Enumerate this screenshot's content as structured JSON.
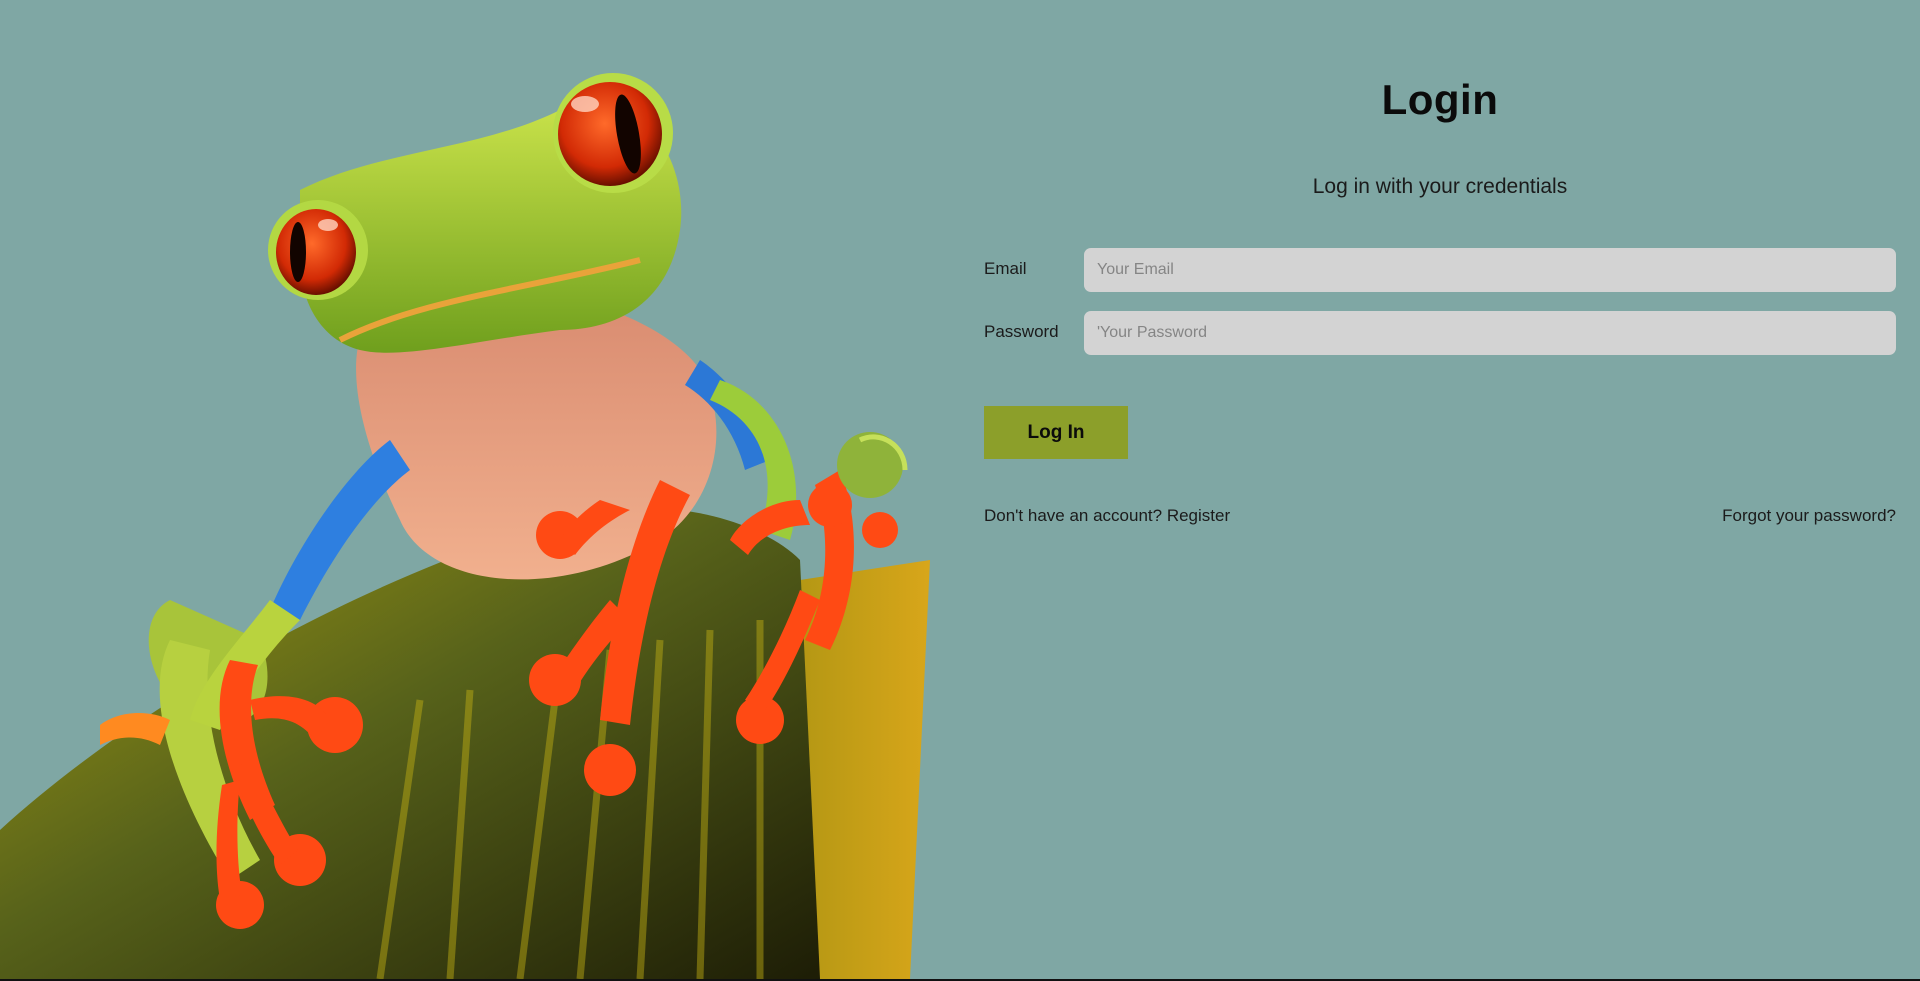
{
  "hero": {
    "image_subject": "frog-on-leaf-illustration"
  },
  "login": {
    "title": "Login",
    "subtitle": "Log in with your credentials",
    "email_label": "Email",
    "email_placeholder": "Your Email",
    "email_value": "",
    "password_label": "Password",
    "password_placeholder": "'Your Password",
    "password_value": "",
    "submit_label": "Log In",
    "register_link": "Don't have an account? Register",
    "forgot_link": "Forgot your password?"
  },
  "colors": {
    "background": "#7fa7a4",
    "input_background": "#d3d3d3",
    "button_background": "#8c9f2a",
    "text": "#0b0b0b"
  }
}
